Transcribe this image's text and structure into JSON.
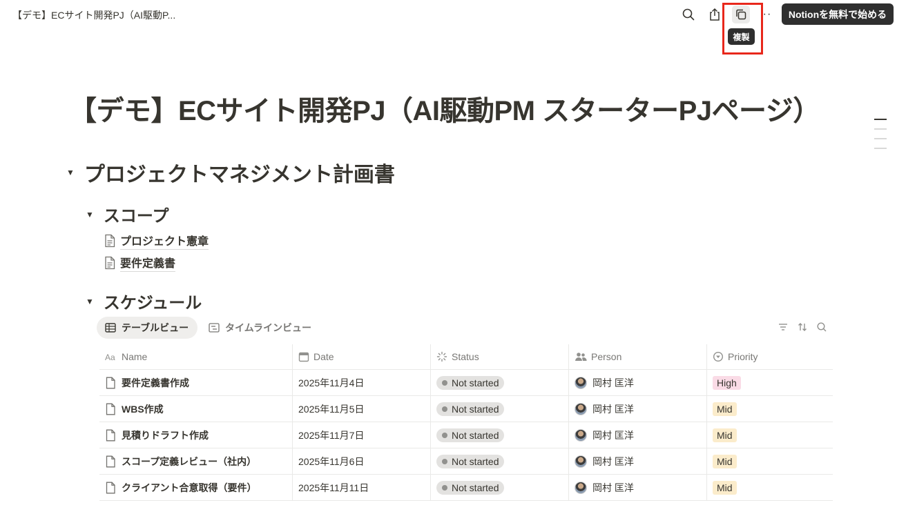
{
  "topbar": {
    "breadcrumb": "【デモ】ECサイト開発PJ（AI駆動P...",
    "tooltip": "複製",
    "cta_label": "Notionを無料で始める",
    "more_label": "··"
  },
  "page": {
    "title": "【デモ】ECサイト開発PJ（AI駆動PM スターターPJページ）"
  },
  "sections": {
    "h1": "プロジェクトマネジメント計画書",
    "scope": "スコープ",
    "scope_links": [
      "プロジェクト憲章",
      "要件定義書"
    ],
    "schedule": "スケジュール"
  },
  "views": {
    "tab1": "テーブルビュー",
    "tab2": "タイムラインビュー"
  },
  "table": {
    "headers": {
      "name": "Name",
      "date": "Date",
      "status": "Status",
      "person": "Person",
      "priority": "Priority"
    },
    "rows": [
      {
        "name": "要件定義書作成",
        "date": "2025年11月4日",
        "status": "Not started",
        "person": "岡村 匡洋",
        "priority": "High"
      },
      {
        "name": "WBS作成",
        "date": "2025年11月5日",
        "status": "Not started",
        "person": "岡村 匡洋",
        "priority": "Mid"
      },
      {
        "name": "見積りドラフト作成",
        "date": "2025年11月7日",
        "status": "Not started",
        "person": "岡村 匡洋",
        "priority": "Mid"
      },
      {
        "name": "スコープ定義レビュー（社内）",
        "date": "2025年11月6日",
        "status": "Not started",
        "person": "岡村 匡洋",
        "priority": "Mid"
      },
      {
        "name": "クライアント合意取得（要件）",
        "date": "2025年11月11日",
        "status": "Not started",
        "person": "岡村 匡洋",
        "priority": "Mid"
      }
    ]
  },
  "colors": {
    "high_bg": "#fadbe6",
    "mid_bg": "#fbeccb",
    "highlight": "#e8271b"
  }
}
